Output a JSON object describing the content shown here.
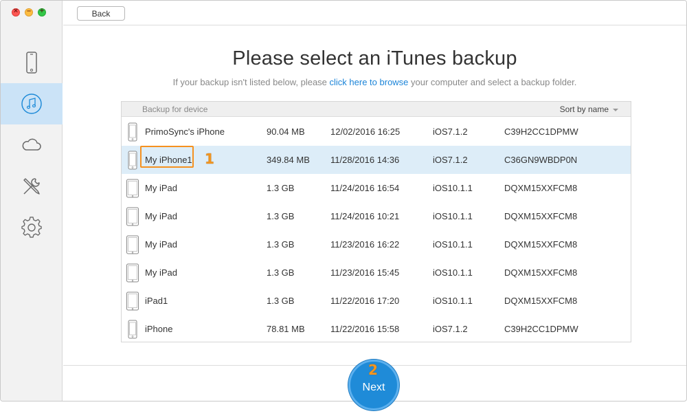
{
  "topbar": {
    "back_label": "Back"
  },
  "page": {
    "title": "Please select an iTunes backup",
    "subtitle_before": "If your backup isn't listed below, please ",
    "subtitle_link": "click here to browse",
    "subtitle_after": " your computer and select a backup folder."
  },
  "sidebar": {
    "items": [
      {
        "icon": "phone-icon",
        "active": false
      },
      {
        "icon": "music-note-icon",
        "active": true
      },
      {
        "icon": "cloud-icon",
        "active": false
      },
      {
        "icon": "tools-icon",
        "active": false
      },
      {
        "icon": "gear-icon",
        "active": false
      }
    ]
  },
  "table": {
    "header_device": "Backup for device",
    "sort_label": "Sort by name",
    "rows": [
      {
        "name": "PrimoSync's iPhone",
        "size": "90.04 MB",
        "date": "12/02/2016 16:25",
        "ios": "iOS7.1.2",
        "id": "C39H2CC1DPMW",
        "device": "iphone"
      },
      {
        "name": "My iPhone1",
        "size": "349.84 MB",
        "date": "11/28/2016 14:36",
        "ios": "iOS7.1.2",
        "id": "C36GN9WBDP0N",
        "device": "iphone"
      },
      {
        "name": "My iPad",
        "size": "1.3 GB",
        "date": "11/24/2016 16:54",
        "ios": "iOS10.1.1",
        "id": "DQXM15XXFCM8",
        "device": "ipad"
      },
      {
        "name": "My iPad",
        "size": "1.3 GB",
        "date": "11/24/2016 10:21",
        "ios": "iOS10.1.1",
        "id": "DQXM15XXFCM8",
        "device": "ipad"
      },
      {
        "name": "My iPad",
        "size": "1.3 GB",
        "date": "11/23/2016 16:22",
        "ios": "iOS10.1.1",
        "id": "DQXM15XXFCM8",
        "device": "ipad"
      },
      {
        "name": "My iPad",
        "size": "1.3 GB",
        "date": "11/23/2016 15:45",
        "ios": "iOS10.1.1",
        "id": "DQXM15XXFCM8",
        "device": "ipad"
      },
      {
        "name": "iPad1",
        "size": "1.3 GB",
        "date": "11/22/2016 17:20",
        "ios": "iOS10.1.1",
        "id": "DQXM15XXFCM8",
        "device": "ipad"
      },
      {
        "name": "iPhone",
        "size": "78.81 MB",
        "date": "11/22/2016 15:58",
        "ios": "iOS7.1.2",
        "id": "C39H2CC1DPMW",
        "device": "iphone"
      }
    ]
  },
  "annotations": {
    "step1": "1",
    "step2": "2"
  },
  "next_label": "Next",
  "colors": {
    "accent": "#1f8bd8",
    "link": "#1b84d8",
    "selected_row": "#ddedf8",
    "sidebar_active": "#cbe3f7",
    "annotation": "#f5911f"
  }
}
